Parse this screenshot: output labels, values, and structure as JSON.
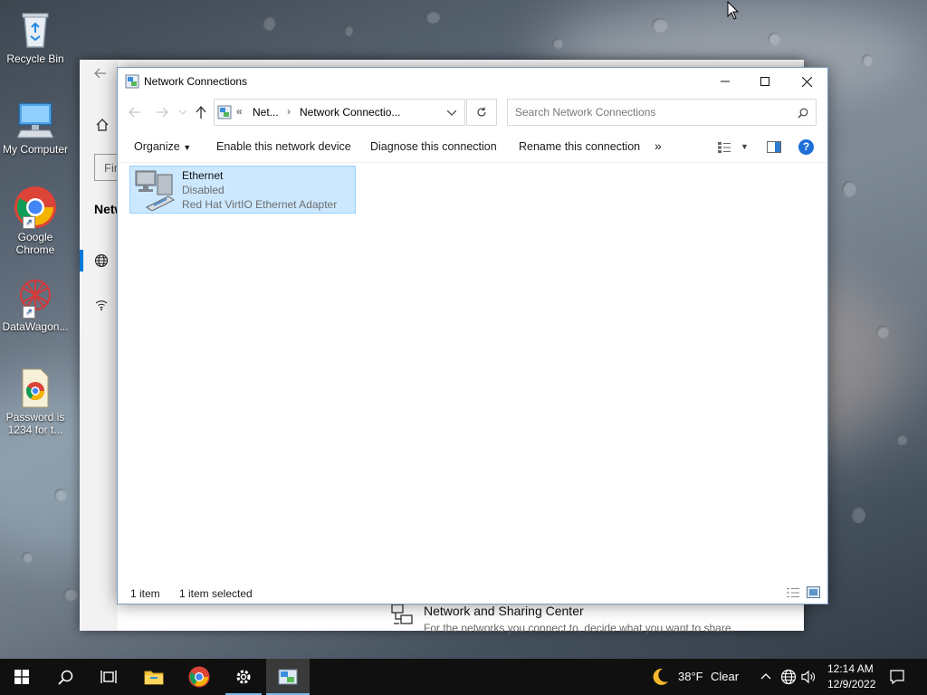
{
  "desktop": {
    "icons": [
      {
        "label": "Recycle Bin",
        "icon": "recycle-bin-icon"
      },
      {
        "label": "My Computer",
        "icon": "computer-icon"
      },
      {
        "label": "Google Chrome",
        "icon": "chrome-icon"
      },
      {
        "label": "DataWagon...",
        "icon": "datawagon-icon"
      },
      {
        "label": "Password is 1234 for t...",
        "icon": "chrome-file-icon"
      }
    ]
  },
  "settings_window": {
    "partial_title": "Netw",
    "search_partial": "Fin",
    "sharing_center": {
      "title": "Network and Sharing Center",
      "description": "For the networks you connect to, decide what you want to share."
    }
  },
  "explorer": {
    "title": "Network Connections",
    "address": {
      "prefix": "«",
      "crumb1": "Net...",
      "crumb2": "Network Connectio..."
    },
    "search_placeholder": "Search Network Connections",
    "commands": {
      "organize": "Organize",
      "enable": "Enable this network device",
      "diagnose": "Diagnose this connection",
      "rename": "Rename this connection",
      "more": "»"
    },
    "items": [
      {
        "name": "Ethernet",
        "status": "Disabled",
        "device": "Red Hat VirtIO Ethernet Adapter"
      }
    ],
    "status": {
      "count": "1 item",
      "selected": "1 item selected"
    }
  },
  "taskbar": {
    "weather": {
      "temp": "38°F",
      "condition": "Clear"
    },
    "clock": {
      "time": "12:14 AM",
      "date": "12/9/2022"
    }
  },
  "colors": {
    "selection": "#cce8ff",
    "taskbar": "#101010",
    "accent": "#0078d7"
  }
}
